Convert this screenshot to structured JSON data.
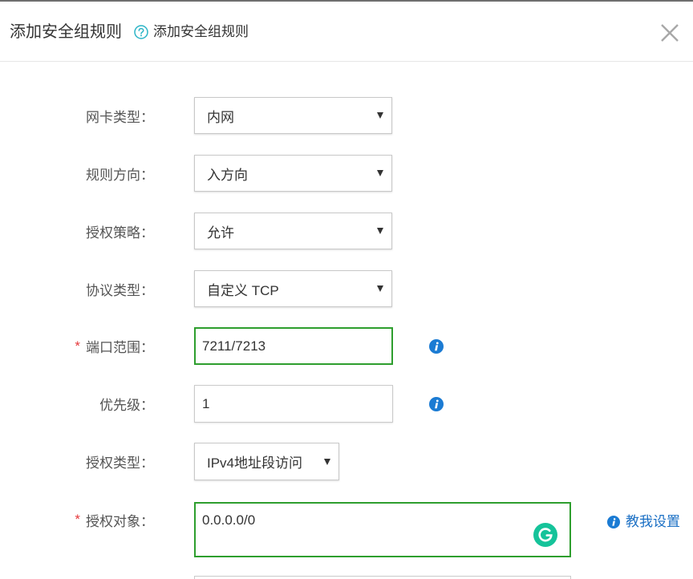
{
  "dialog": {
    "title": "添加安全组规则",
    "help_link": "添加安全组规则"
  },
  "icons": {
    "help": "question-circle-icon",
    "close": "close-icon",
    "dropdown": "caret-down-icon",
    "info": "info-circle-icon",
    "grammarly": "grammarly-icon"
  },
  "colors": {
    "valid_border": "#2e9e2e",
    "required_mark": "#e5393c",
    "link": "#1a6fc4",
    "info_icon": "#1b7bd3",
    "help_icon": "#2bb4c6",
    "grammarly": "#15c39a"
  },
  "form": {
    "required_mark": "*",
    "nic_type": {
      "label": "网卡类型：",
      "value": "内网"
    },
    "direction": {
      "label": "规则方向：",
      "value": "入方向"
    },
    "policy": {
      "label": "授权策略：",
      "value": "允许"
    },
    "protocol": {
      "label": "协议类型：",
      "value": "自定义 TCP"
    },
    "port_range": {
      "label": "端口范围：",
      "value": "7211/7213",
      "required": true
    },
    "priority": {
      "label": "优先级：",
      "value": "1"
    },
    "auth_type": {
      "label": "授权类型：",
      "value": "IPv4地址段访问"
    },
    "auth_object": {
      "label": "授权对象：",
      "value": "0.0.0.0/0",
      "required": true,
      "help_link": "教我设置"
    }
  }
}
